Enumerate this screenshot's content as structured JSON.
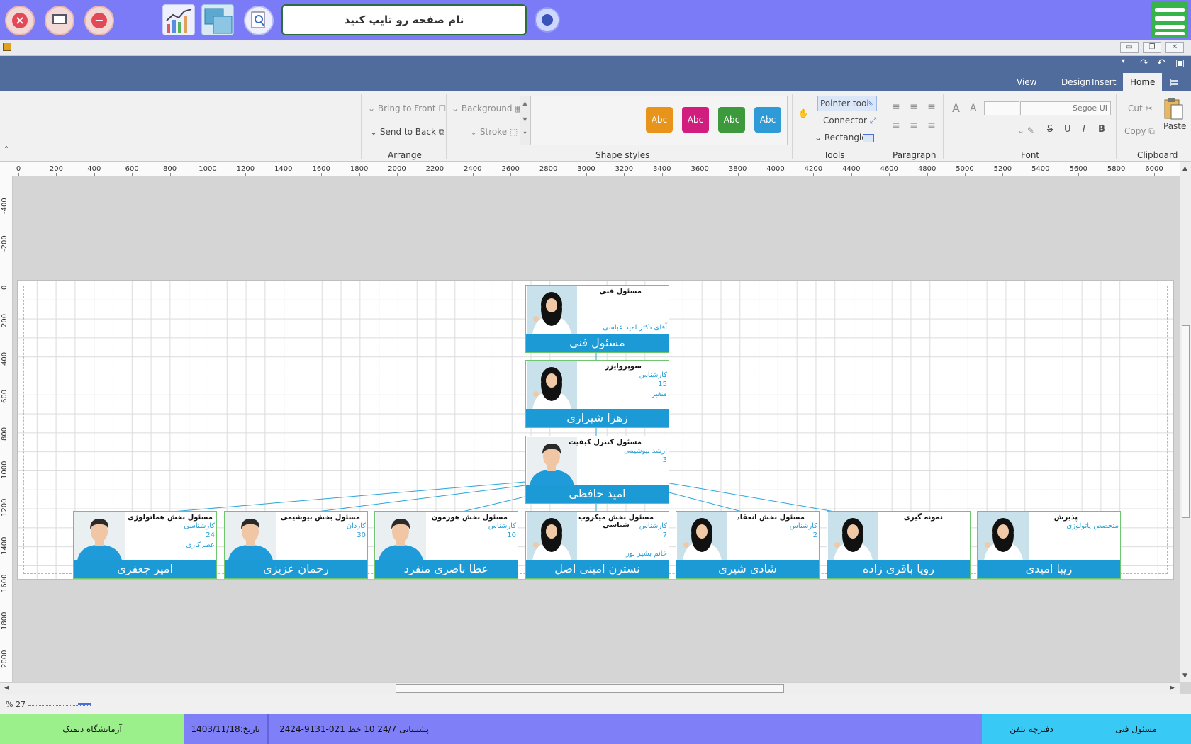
{
  "topbar": {
    "search_placeholder": "نام صفحه رو تایپ کنید",
    "buttons": [
      "close-icon",
      "monitor-icon",
      "minimize-icon",
      "chart-icon",
      "windows-icon",
      "zoom-page-icon",
      "refresh-icon",
      "hamburger-menu-icon"
    ]
  },
  "ribbon": {
    "tabs": [
      "Home",
      "Insert",
      "Design",
      "View"
    ],
    "active_tab": "Home",
    "clipboard": {
      "label": "Clipboard",
      "paste": "Paste",
      "cut": "Cut",
      "copy": "Copy"
    },
    "font": {
      "label": "Font",
      "family": "Segoe UI",
      "size": "",
      "bold": "B",
      "italic": "I",
      "underline": "U",
      "strike": "S"
    },
    "paragraph": {
      "label": "Paragraph"
    },
    "tools": {
      "label": "Tools",
      "pointer": "Pointer tool",
      "connector": "Connector",
      "rectangle": "Rectangle"
    },
    "shape_styles": {
      "label": "Shape styles",
      "items": [
        "Abc",
        "Abc",
        "Abc",
        "Abc"
      ],
      "colors": [
        "#2e9bd6",
        "#3c9a3c",
        "#d01d7e",
        "#e8941a"
      ]
    },
    "arrange": {
      "label": "Arrange",
      "bring_front": "Bring to Front",
      "send_back": "Send to Back",
      "background": "Background",
      "stroke": "Stroke"
    }
  },
  "ruler": {
    "h_ticks": [
      "0",
      "200",
      "400",
      "600",
      "800",
      "1000",
      "1200",
      "1400",
      "1600",
      "1800",
      "2000",
      "2200",
      "2400",
      "2600",
      "2800",
      "3000",
      "3200",
      "3400",
      "3600",
      "3800",
      "4000",
      "4200",
      "4400",
      "4600",
      "4800",
      "5000",
      "5200",
      "5400",
      "5600",
      "5800",
      "6000"
    ],
    "v_ticks": [
      "-400",
      "-200",
      "0",
      "200",
      "400",
      "600",
      "800",
      "1000",
      "1200",
      "1400",
      "1600",
      "1800",
      "2000"
    ]
  },
  "org": {
    "top": {
      "role": "مسئول فنی",
      "line1": "آقای دکتر امید عباسی",
      "name": "مسئول فنی"
    },
    "supervisor": {
      "role": "سوپروایزر",
      "line1": "کارشناس",
      "line2": "15",
      "line3": "متغیر",
      "name": "زهرا شیرازی"
    },
    "qc": {
      "role": "مسئول کنترل کیفیت",
      "line1": "ارشد بیوشیمی",
      "line2": "3",
      "name": "امید حافظی"
    },
    "bottom": [
      {
        "role": "مسئول بخش هماتولوژی",
        "line1": "کارشناسی",
        "line2": "24",
        "line3": "عصرکاری",
        "name": "امیر جعفری",
        "gender": "male"
      },
      {
        "role": "مسئول بخش بیوشیمی",
        "line1": "کاردان",
        "line2": "30",
        "line3": "",
        "name": "رحمان عزیزی",
        "gender": "male"
      },
      {
        "role": "مسئول بخش هورمون",
        "line1": "کارشناس",
        "line2": "10",
        "line3": "",
        "name": "عطا ناصری منفرد",
        "gender": "male"
      },
      {
        "role": "مسئول بخش میکروب شناسی",
        "line1": "کارشناس",
        "line2": "7",
        "line3": "خانم بشیر پور",
        "name": "نسترن امینی اصل",
        "gender": "female"
      },
      {
        "role": "مسئول بخش انعقاد",
        "line1": "کارشناس",
        "line2": "2",
        "line3": "",
        "name": "شادی شیری",
        "gender": "female"
      },
      {
        "role": "نمونه گیری",
        "line1": "",
        "line2": "",
        "line3": "",
        "name": "رویا  باقری زاده",
        "gender": "female"
      },
      {
        "role": "پذیرش",
        "line1": "متخصص پاتولوژی",
        "line2": "",
        "line3": "",
        "name": "زیبا امیدی",
        "gender": "female"
      }
    ]
  },
  "zoom": {
    "label": "% 27",
    "value_percent": 27
  },
  "status": {
    "lab": "آزمایشگاه دیمیک",
    "date": "تاریخ:1403/11/18",
    "support": "پشتیبانی 24/7     10 خط    021-9131-2424",
    "phonebook": "دفترچه تلفن",
    "user": "مسئول فنی",
    "colors": {
      "lab": "#9cf08c",
      "date": "#7f7ff7",
      "support": "#7f7ff7",
      "phonebook": "#38c9f5",
      "user": "#38c9f5"
    }
  }
}
